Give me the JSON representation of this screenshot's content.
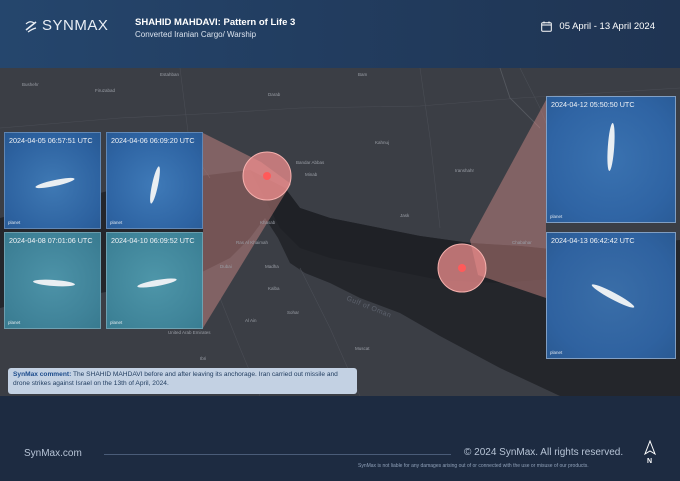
{
  "brand": {
    "name": "SYNMAX"
  },
  "header": {
    "title": "SHAHID MAHDAVI: Pattern of Life 3",
    "subtitle": "Converted Iranian Cargo/ Warship",
    "date_range": "05 April - 13 April 2024"
  },
  "map": {
    "places": [
      "Bushehr",
      "Firuzabad",
      "Estahban",
      "Darab",
      "Bam",
      "Minab",
      "Bandar Abbas",
      "Khasab",
      "Ras Al Khaimah",
      "Dubai",
      "Abu Dhabi",
      "Muscat",
      "Sohar",
      "Madha",
      "Kalba",
      "Al Ain",
      "Ibri",
      "Jask",
      "Chabahar",
      "Iranshahr",
      "Kahnuj",
      "United Arab Emirates",
      "Oman"
    ],
    "sea_label": "Gulf of Oman"
  },
  "thumbnails": [
    {
      "timestamp": "2024-04-05 06:57:51 UTC",
      "watermark": "planet"
    },
    {
      "timestamp": "2024-04-06 06:09:20 UTC",
      "watermark": "planet"
    },
    {
      "timestamp": "2024-04-08 07:01:06 UTC",
      "watermark": "planet"
    },
    {
      "timestamp": "2024-04-10 06:09:52 UTC",
      "watermark": "planet"
    },
    {
      "timestamp": "2024-04-12 05:50:50 UTC",
      "watermark": "planet"
    },
    {
      "timestamp": "2024-04-13 06:42:42 UTC",
      "watermark": "planet"
    }
  ],
  "comment": {
    "label": "SynMax comment:",
    "text": " The SHAHID MAHDAVI before and after leaving its anchorage. Iran carried out missile and drone strikes against Israel on the 13th of April, 2024."
  },
  "footer": {
    "url": "SynMax.com",
    "copyright": "© 2024 SynMax. All rights reserved.",
    "disclaimer": "SynMax is not liable for any damages arising out of or connected with the use or misuse of our products.",
    "north": "N"
  },
  "colors": {
    "highlight": "#f08a8a",
    "accent": "#2c4a73",
    "comment_bg": "#c3d1e3"
  }
}
